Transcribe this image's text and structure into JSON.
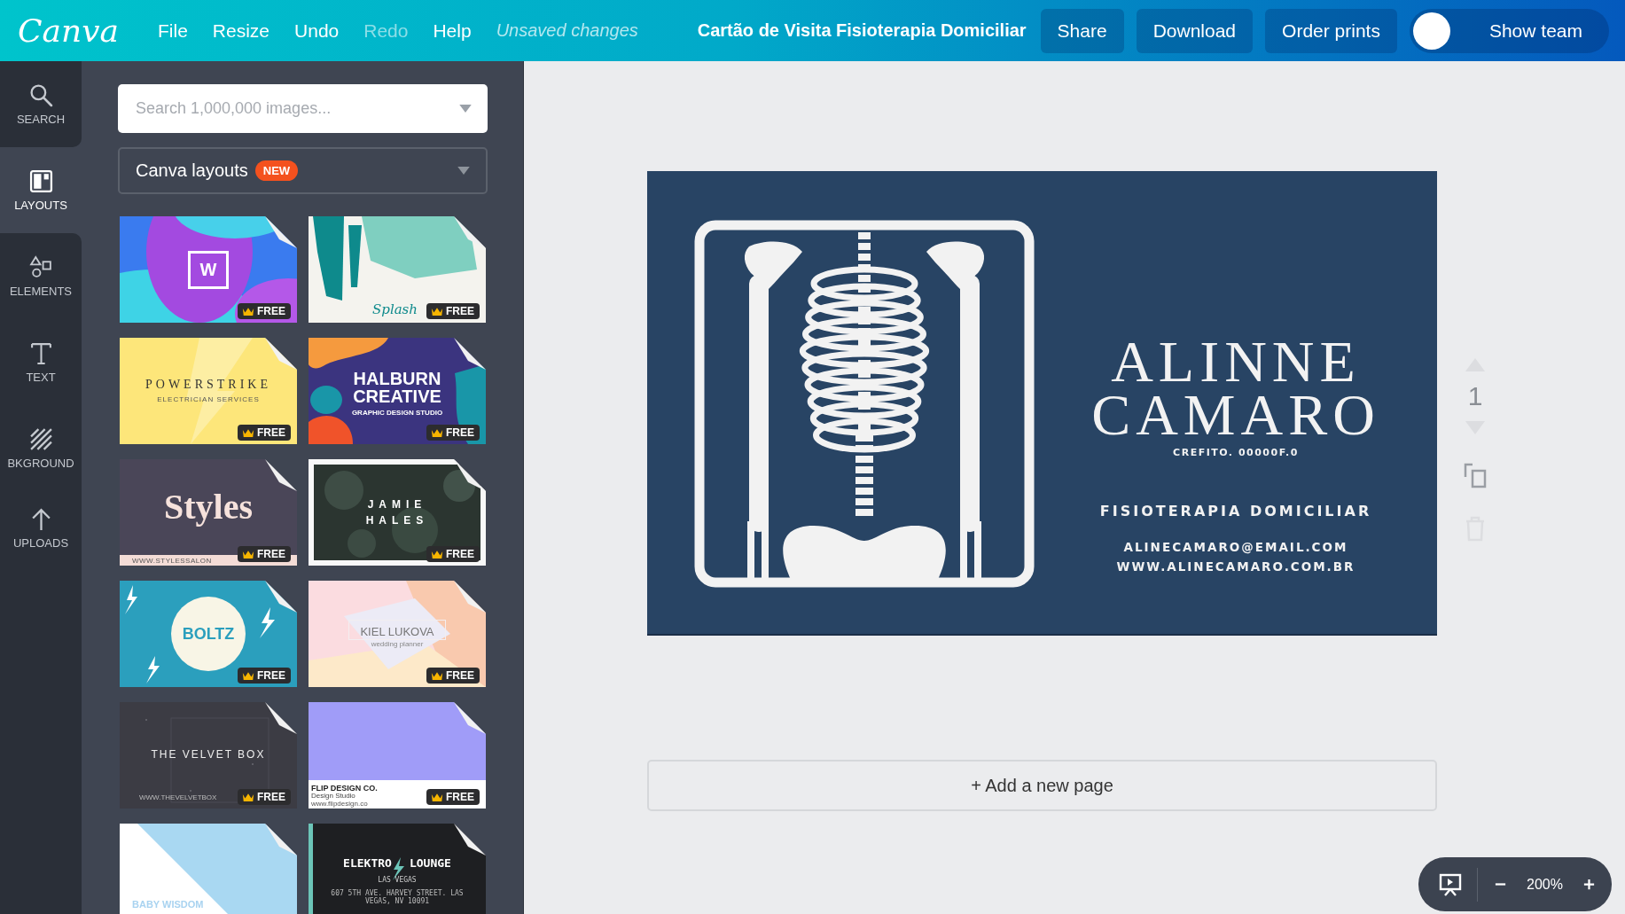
{
  "topbar": {
    "logo": "Canva",
    "menu": [
      {
        "label": "File",
        "disabled": false
      },
      {
        "label": "Resize",
        "disabled": false
      },
      {
        "label": "Undo",
        "disabled": false
      },
      {
        "label": "Redo",
        "disabled": true
      },
      {
        "label": "Help",
        "disabled": false
      }
    ],
    "status": "Unsaved changes",
    "title": "Cartão de Visita Fisioterapia Domiciliar",
    "buttons": [
      "Share",
      "Download",
      "Order prints"
    ],
    "team_toggle": {
      "label": "Show team",
      "on": false
    }
  },
  "sidebar": {
    "items": [
      {
        "label": "SEARCH",
        "kind": "search",
        "selected": false
      },
      {
        "label": "LAYOUTS",
        "kind": "layouts",
        "selected": true
      },
      {
        "label": "ELEMENTS",
        "kind": "elements",
        "selected": false
      },
      {
        "label": "TEXT",
        "kind": "text",
        "selected": false
      },
      {
        "label": "BKGROUND",
        "kind": "background",
        "selected": false
      },
      {
        "label": "UPLOADS",
        "kind": "uploads",
        "selected": false
      }
    ]
  },
  "panel": {
    "search": {
      "placeholder": "Search 1,000,000 images..."
    },
    "source": {
      "label": "Canva layouts",
      "badge": "NEW"
    },
    "layouts": [
      {
        "kind": "waves",
        "lines": [
          "W"
        ],
        "badge": "FREE"
      },
      {
        "kind": "brush",
        "lines": [
          "Splash"
        ],
        "badge": "FREE"
      },
      {
        "kind": "yellow",
        "lines": [
          "POWERSTRIKE",
          "ELECTRICIAN SERVICES"
        ],
        "badge": "FREE"
      },
      {
        "kind": "halburn",
        "lines": [
          "HALBURN",
          "CREATIVE",
          "GRAPHIC DESIGN STUDIO"
        ],
        "badge": "FREE"
      },
      {
        "kind": "styles",
        "lines": [
          "Styles",
          "WWW.STYLESSALON"
        ],
        "badge": "FREE"
      },
      {
        "kind": "succulent",
        "lines": [
          "JAMIE",
          "HALES"
        ],
        "badge": "FREE"
      },
      {
        "kind": "boltz",
        "lines": [
          "BOLTZ"
        ],
        "badge": "FREE"
      },
      {
        "kind": "kiel",
        "lines": [
          "KIEL LUKOVA",
          "wedding planner"
        ],
        "badge": "FREE"
      },
      {
        "kind": "velvet",
        "lines": [
          "THE VELVET BOX",
          "WWW.THEVELVETBOX"
        ],
        "badge": "FREE"
      },
      {
        "kind": "flip",
        "lines": [
          "FLIP DESIGN CO.",
          "Design Studio",
          "www.flipdesign.co"
        ],
        "badge": "FREE"
      },
      {
        "kind": "baby",
        "lines": [
          "BABY WISDOM"
        ]
      },
      {
        "kind": "elektro",
        "lines": [
          "ELEKTRO",
          "LOUNGE",
          "LAS VEGAS",
          "607 5TH AVE. HARVEY STREET. LAS VEGAS, NV 10091"
        ]
      }
    ]
  },
  "card": {
    "name_lines": [
      "ALINNE",
      "CAMARO"
    ],
    "registration": "CREFITO. 00000F.0",
    "specialty": "FISIOTERAPIA DOMICILIAR",
    "contacts": [
      "ALINECAMARO@EMAIL.COM",
      "WWW.ALINECAMARO.COM.BR"
    ]
  },
  "page_controls": {
    "page_number": "1"
  },
  "add_page": "+ Add a new page",
  "zoom": {
    "value": "200%"
  }
}
